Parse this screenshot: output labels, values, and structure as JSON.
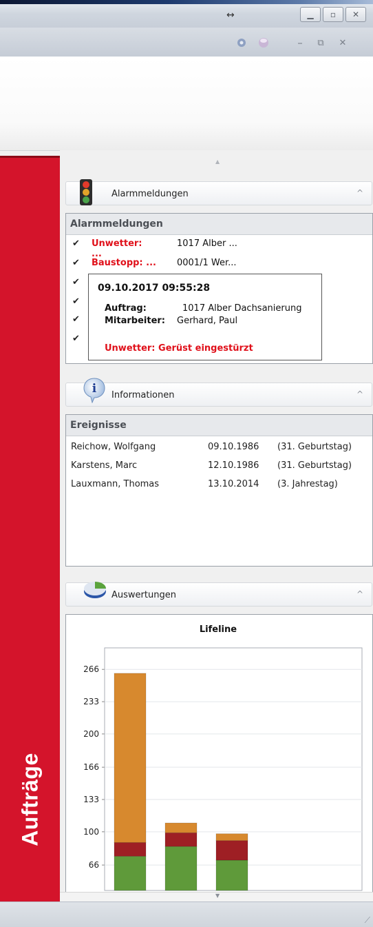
{
  "sidebar": {
    "label": "Aufträge"
  },
  "groups": {
    "alarm": {
      "title": "Alarmmeldungen"
    },
    "info": {
      "title": "Informationen"
    },
    "eval": {
      "title": "Auswertungen"
    }
  },
  "alarm_panel": {
    "header": "Alarmmeldungen",
    "rows": [
      {
        "type": "Unwetter: ...",
        "text": "1017 Alber ..."
      },
      {
        "type": "Baustopp: ...",
        "text": "0001/1 Wer..."
      }
    ],
    "tooltip": {
      "datetime": "09.10.2017 09:55:28",
      "auftrag_label": "Auftrag:",
      "auftrag_value": "1017 Alber Dachsanierung",
      "mitarbeiter_label": "Mitarbeiter:",
      "mitarbeiter_value": "Gerhard, Paul",
      "message": "Unwetter: Gerüst eingestürzt"
    }
  },
  "events_panel": {
    "header": "Ereignisse",
    "rows": [
      {
        "name": "Reichow, Wolfgang",
        "date": "09.10.1986",
        "note": "(31. Geburtstag)"
      },
      {
        "name": "Karstens, Marc",
        "date": "12.10.1986",
        "note": "(31. Geburtstag)"
      },
      {
        "name": "Lauxmann, Thomas",
        "date": "13.10.2014",
        "note": "(3. Jahrestag)"
      }
    ]
  },
  "colors": {
    "sidebar": "#d4142b",
    "alarm_red": "#e0101a",
    "seg_green": "#5f9a3a",
    "seg_red": "#9e1f24",
    "seg_orange": "#d7892e"
  },
  "chart_data": {
    "type": "bar",
    "title": "Lifeline",
    "yticks": [
      66,
      100,
      133,
      166,
      200,
      233,
      266
    ],
    "ylim": [
      40,
      288
    ],
    "categories": [
      "",
      "",
      ""
    ],
    "series": [
      {
        "color": "#5f9a3a",
        "values": [
          75,
          85,
          71
        ]
      },
      {
        "color": "#9e1f24",
        "values": [
          14,
          14,
          20
        ]
      },
      {
        "color": "#d7892e",
        "values": [
          173,
          10,
          7
        ]
      }
    ]
  }
}
